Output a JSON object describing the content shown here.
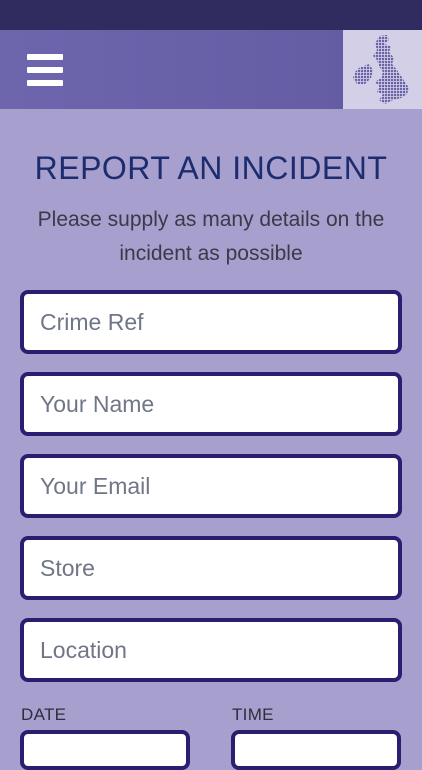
{
  "header": {
    "menu_icon": "hamburger-menu-icon",
    "logo_icon": "uk-map-logo-icon"
  },
  "form": {
    "title": "REPORT AN INCIDENT",
    "subtitle": "Please supply as many details on the incident as possible",
    "fields": {
      "crime_ref": {
        "placeholder": "Crime Ref",
        "value": ""
      },
      "name": {
        "placeholder": "Your Name",
        "value": ""
      },
      "email": {
        "placeholder": "Your Email",
        "value": ""
      },
      "store": {
        "placeholder": "Store",
        "value": ""
      },
      "location": {
        "placeholder": "Location",
        "value": ""
      }
    },
    "date_label": "DATE",
    "time_label": "TIME"
  },
  "colors": {
    "status_bar": "#302c60",
    "header": "#6760a8",
    "background": "#a79fcd",
    "title": "#1d2c6e",
    "field_border": "#2a1e70"
  }
}
